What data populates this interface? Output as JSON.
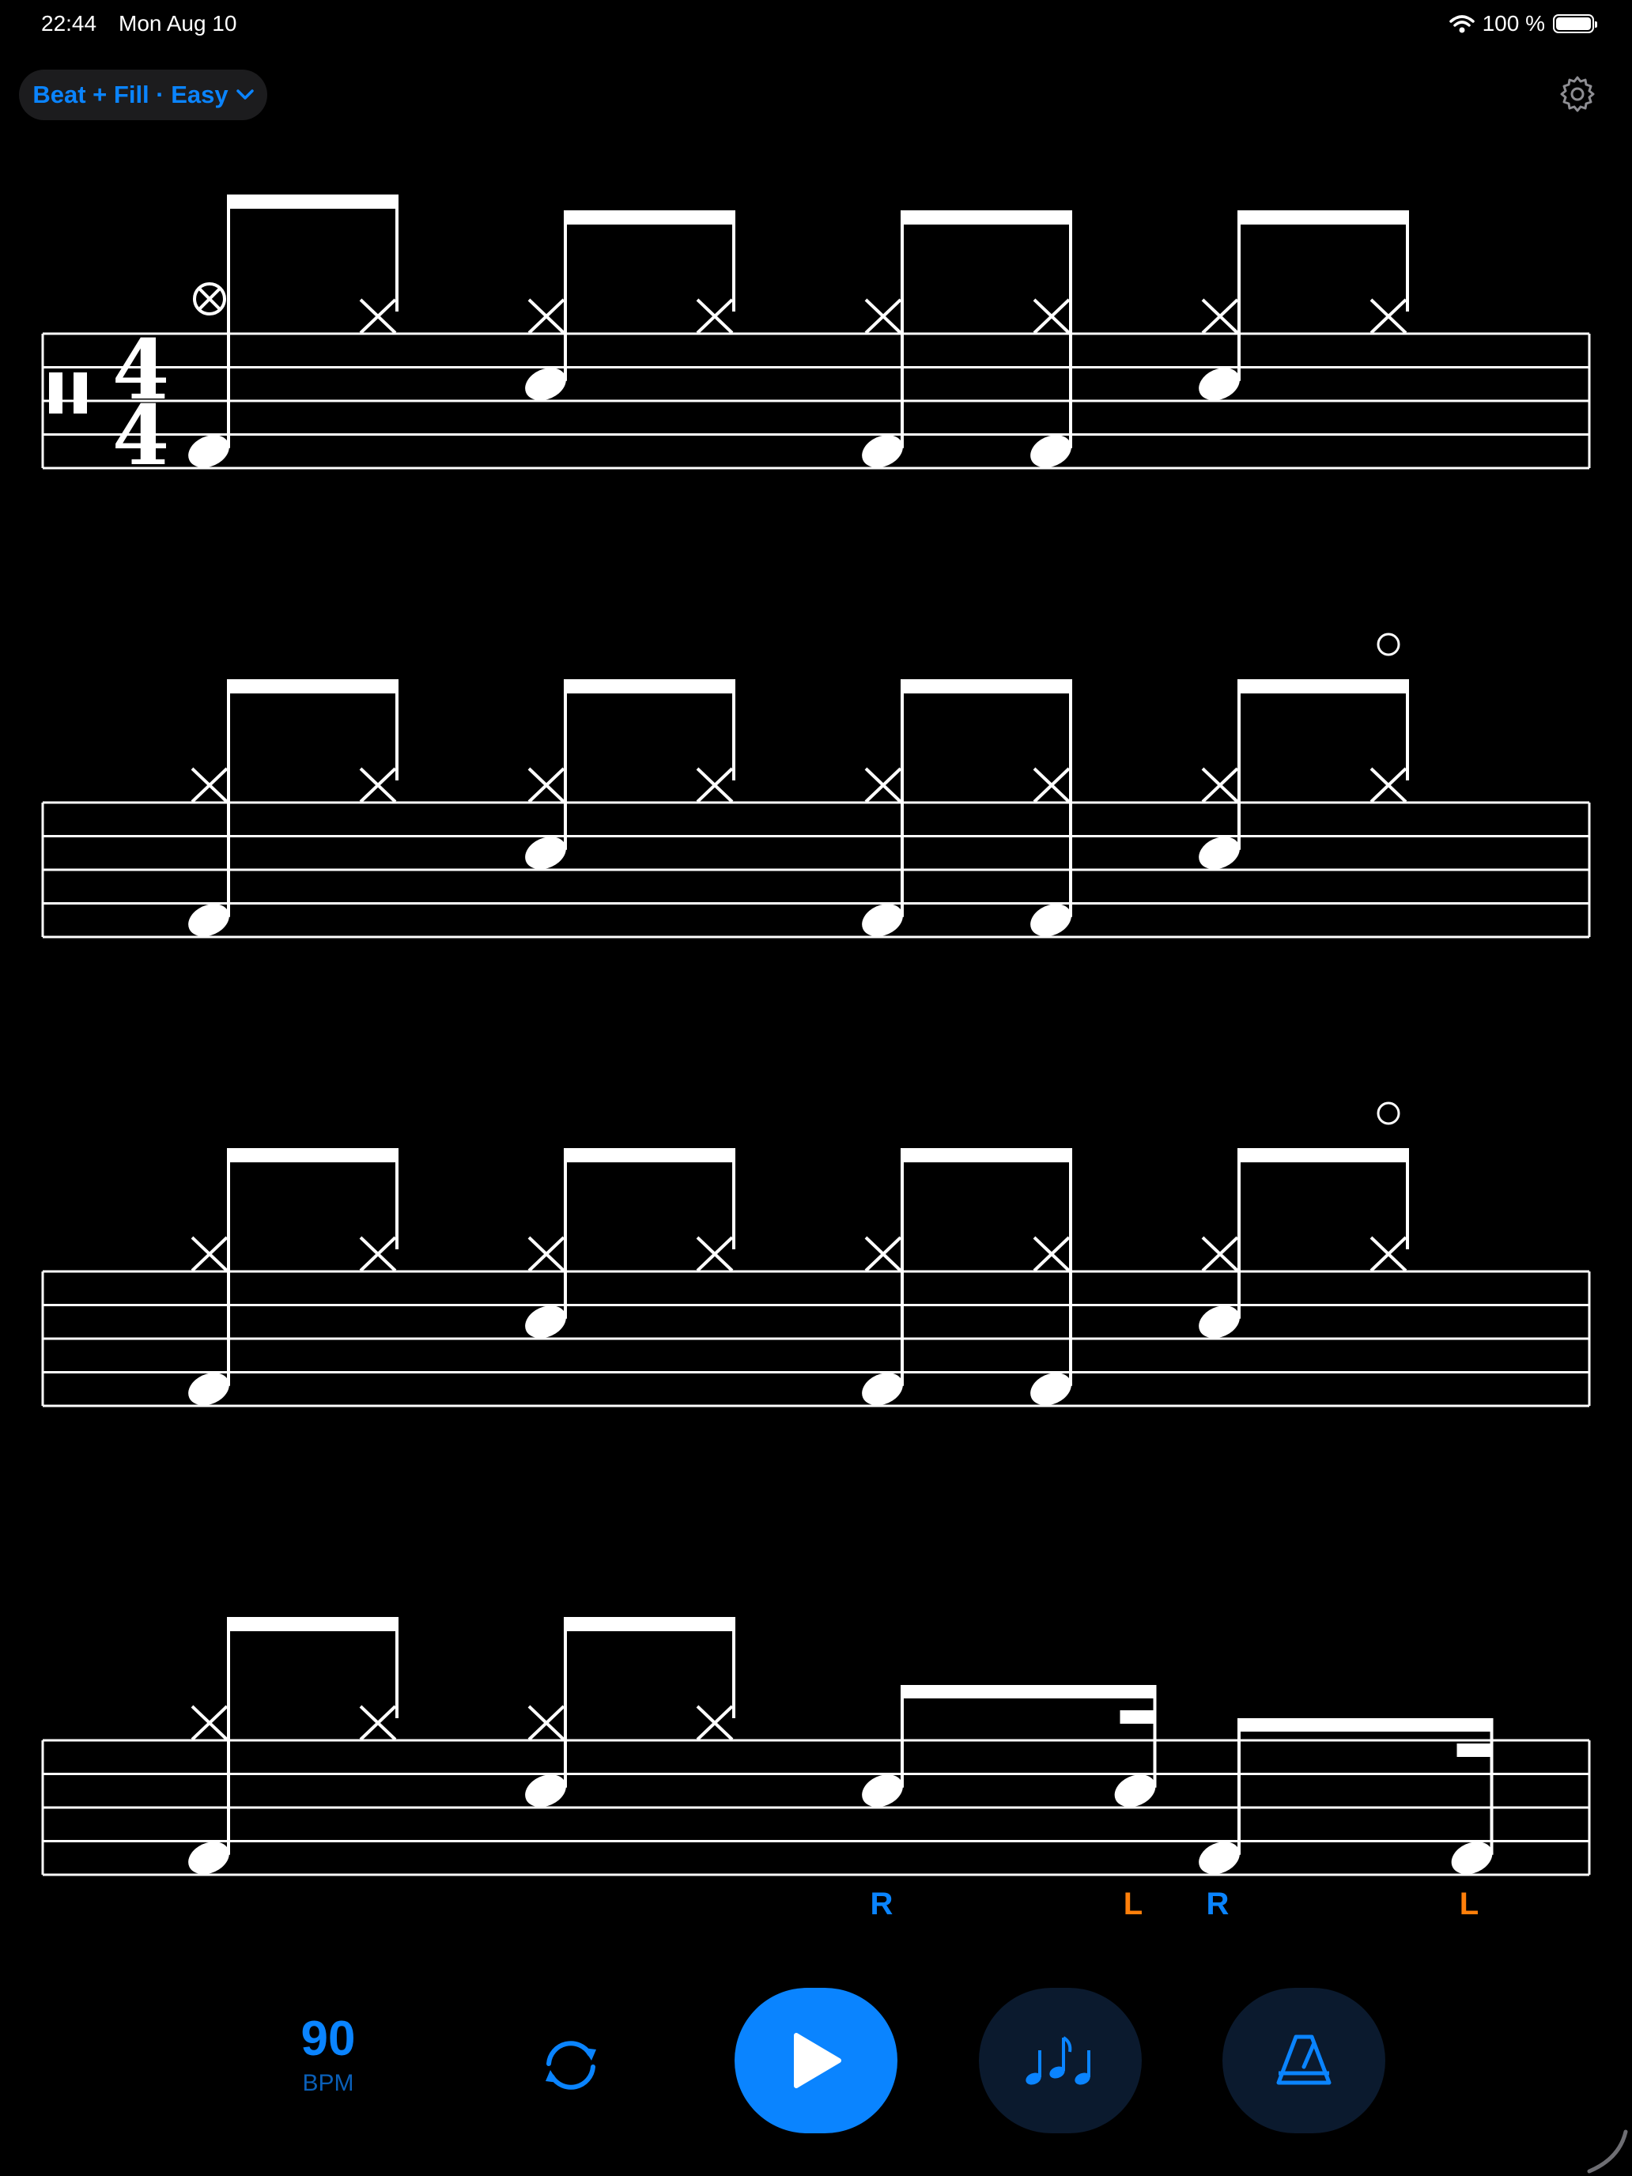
{
  "status_bar": {
    "time": "22:44",
    "date": "Mon Aug 10",
    "battery_text": "100 %",
    "icons": [
      "wifi-icon",
      "battery-icon"
    ]
  },
  "header": {
    "mode_selector": {
      "label": "Beat + Fill · Easy",
      "icon": "chevron-down-icon"
    },
    "settings_icon": "gear-icon"
  },
  "score": {
    "time_signature": {
      "numerator": "4",
      "denominator": "4"
    },
    "clef": "percussion",
    "notes_per_system": 8,
    "systems": [
      {
        "hihat": [
          "crash",
          "x",
          "x",
          "x",
          "x",
          "x",
          "x",
          "x"
        ],
        "middle": [
          false,
          false,
          true,
          false,
          false,
          false,
          true,
          false
        ],
        "low": [
          true,
          false,
          false,
          false,
          true,
          true,
          false,
          false
        ],
        "open_marks": [],
        "fill": false
      },
      {
        "hihat": [
          "x",
          "x",
          "x",
          "x",
          "x",
          "x",
          "x",
          "x"
        ],
        "middle": [
          false,
          false,
          true,
          false,
          false,
          false,
          true,
          false
        ],
        "low": [
          true,
          false,
          false,
          false,
          true,
          true,
          false,
          false
        ],
        "open_marks": [
          7
        ],
        "fill": false
      },
      {
        "hihat": [
          "x",
          "x",
          "x",
          "x",
          "x",
          "x",
          "x",
          "x"
        ],
        "middle": [
          false,
          false,
          true,
          false,
          false,
          false,
          true,
          false
        ],
        "low": [
          true,
          false,
          false,
          false,
          true,
          true,
          false,
          false
        ],
        "open_marks": [
          7
        ],
        "fill": false
      },
      {
        "hihat": [
          "x",
          "x",
          "x",
          "x"
        ],
        "middle": [
          false,
          false,
          true,
          false
        ],
        "low": [
          true,
          false,
          false,
          false
        ],
        "open_marks": [],
        "fill": true,
        "fill_notes": [
          {
            "beat": 4,
            "pos": "middle",
            "sticking": "R"
          },
          {
            "beat": 5.5,
            "pos": "middle",
            "sticking": "L"
          },
          {
            "beat": 6,
            "pos": "low",
            "sticking": "R"
          },
          {
            "beat": 7.5,
            "pos": "low",
            "sticking": "L"
          }
        ]
      }
    ],
    "sticking": [
      "R",
      "L",
      "R",
      "L"
    ]
  },
  "controls": {
    "bpm_value": "90",
    "bpm_label": "BPM",
    "loop_icon": "loop-icon",
    "play_icon": "play-icon",
    "notes_icon": "notes-icon",
    "metronome_icon": "metronome-icon"
  },
  "colors": {
    "accent": "#0a84ff",
    "right_hand": "#0a84ff",
    "left_hand": "#ff7f0a",
    "background": "#000000",
    "staff": "#ffffff",
    "button_dark": "#0b1a2e",
    "pill_bg": "#1c1c1e"
  }
}
